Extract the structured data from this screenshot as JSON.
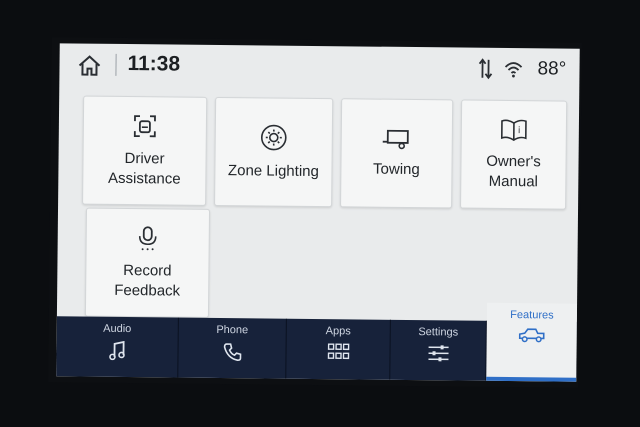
{
  "status": {
    "time": "11:38",
    "temperature": "88°",
    "icons": [
      "home-icon",
      "signal-arrows-icon",
      "wifi-icon"
    ]
  },
  "tiles": [
    {
      "label": "Driver\nAssistance",
      "icon": "driver-assist-icon"
    },
    {
      "label": "Zone Lighting",
      "icon": "light-icon"
    },
    {
      "label": "Towing",
      "icon": "trailer-icon"
    },
    {
      "label": "Owner's Manual",
      "icon": "book-icon"
    },
    {
      "label": "Record\nFeedback",
      "icon": "microphone-icon"
    }
  ],
  "nav": {
    "audio": "Audio",
    "phone": "Phone",
    "apps": "Apps",
    "settings": "Settings",
    "features": "Features"
  },
  "colors": {
    "accent": "#2f6fc7",
    "nav_background": "#17223a",
    "panel_background": "#e9ebec"
  }
}
